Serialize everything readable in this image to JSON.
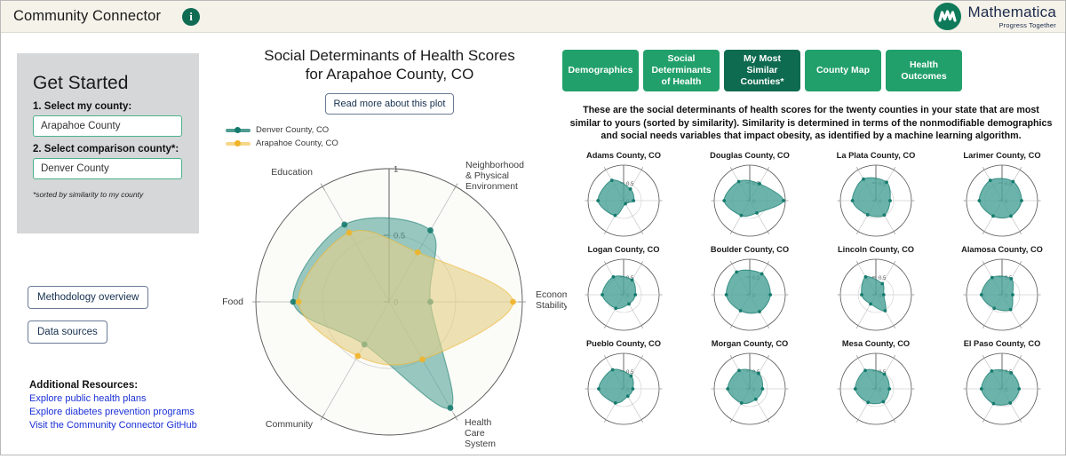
{
  "header": {
    "title": "Community Connector",
    "info_icon": "info-icon",
    "logo_name": "Mathematica",
    "logo_tagline": "Progress Together"
  },
  "sidebar": {
    "title": "Get Started",
    "label_my_county": "1. Select my county:",
    "my_county_value": "Arapahoe County",
    "label_comparison_county": "2. Select comparison county*:",
    "comparison_county_value": "Denver County",
    "note": "*sorted by similarity to my county",
    "buttons": [
      {
        "label": "Methodology overview"
      },
      {
        "label": "Data sources"
      }
    ],
    "resources_title": "Additional Resources:",
    "resources": [
      {
        "label": "Explore public health plans"
      },
      {
        "label": "Explore diabetes prevention programs"
      },
      {
        "label": "Visit the Community Connector GitHub"
      }
    ]
  },
  "chart_panel": {
    "title_line1": "Social Determinants of Health Scores",
    "title_line2": "for Arapahoe County, CO",
    "read_more_label": "Read more about this plot"
  },
  "right_panel": {
    "tabs": [
      {
        "label": "Demographics",
        "active": false
      },
      {
        "label": "Social Determinants of Health",
        "active": false
      },
      {
        "label": "My Most Similar Counties*",
        "active": true
      },
      {
        "label": "County Map",
        "active": false
      },
      {
        "label": "Health Outcomes",
        "active": false
      }
    ],
    "description": "These are the social determinants of health scores for the twenty counties in your state that are most similar to yours (sorted by similarity). Similarity is determined in terms of the nonmodifiable demographics and social needs variables that impact obesity, as identified by a machine learning algorithm."
  },
  "colors": {
    "denver_teal": "#167b6e",
    "denver_fill": "#5aa79d",
    "arapahoe_yellow": "#f0b429",
    "arapahoe_fill": "#e3d089",
    "tab_green": "#22a06b",
    "tab_active_green": "#0f6b4f",
    "link_blue": "#1a2fd6",
    "panel_gray": "#d5d7d9",
    "header_cream": "#f5f2ea"
  },
  "chart_data": {
    "type": "radar",
    "title": "Social Determinants of Health Scores for Arapahoe County, CO",
    "axes": [
      "Neighborhood & Physical Environment",
      "Economic Stability",
      "Health Care System",
      "Community",
      "Food",
      "Education"
    ],
    "axis_label_lines": [
      [
        "Neighborhood",
        "& Physical",
        "Environment"
      ],
      [
        "Economic",
        "Stability"
      ],
      [
        "Health",
        "Care",
        "System"
      ],
      [
        "Community"
      ],
      [
        "Food"
      ],
      [
        "Education"
      ]
    ],
    "radial_ticks": [
      0,
      0.5,
      1
    ],
    "radial_tick_labels": [
      "0",
      "0.5",
      "1"
    ],
    "rlim": [
      0,
      1
    ],
    "series": [
      {
        "name": "Denver County, CO",
        "color": "#167b6e",
        "fill": "#5aa79d",
        "values": [
          0.62,
          0.31,
          0.92,
          0.37,
          0.72,
          0.67
        ]
      },
      {
        "name": "Arapahoe County, CO",
        "color": "#f0b429",
        "fill": "#e3d089",
        "values": [
          0.43,
          0.93,
          0.5,
          0.47,
          0.68,
          0.6
        ]
      }
    ],
    "legend": [
      {
        "label": "Denver County, CO",
        "color": "#167b6e"
      },
      {
        "label": "Arapahoe County, CO",
        "color": "#f0b429"
      }
    ],
    "legend_position": "top-left"
  },
  "small_multiples": {
    "type": "radar-grid",
    "axes": [
      "Neighborhood & Physical Environment",
      "Economic Stability",
      "Health Care System",
      "Community",
      "Food",
      "Education"
    ],
    "radial_ticks": [
      0,
      0.5
    ],
    "radial_tick_labels": [
      "0",
      "0.5"
    ],
    "color": "#167b6e",
    "fill": "#4aa298",
    "charts": [
      {
        "title": "Adams County, CO",
        "values": [
          0.38,
          0.28,
          0.1,
          0.48,
          0.72,
          0.66
        ]
      },
      {
        "title": "Douglas County, CO",
        "values": [
          0.55,
          0.95,
          0.4,
          0.48,
          0.72,
          0.62
        ]
      },
      {
        "title": "La Plata County, CO",
        "values": [
          0.6,
          0.4,
          0.47,
          0.46,
          0.66,
          0.7
        ]
      },
      {
        "title": "Larimer County, CO",
        "values": [
          0.62,
          0.55,
          0.5,
          0.5,
          0.64,
          0.66
        ]
      },
      {
        "title": "Logan County, CO",
        "values": [
          0.48,
          0.33,
          0.3,
          0.44,
          0.6,
          0.58
        ]
      },
      {
        "title": "Boulder County, CO",
        "values": [
          0.68,
          0.58,
          0.55,
          0.52,
          0.66,
          0.74
        ]
      },
      {
        "title": "Lincoln County, CO",
        "values": [
          0.36,
          0.22,
          0.52,
          0.3,
          0.4,
          0.58
        ]
      },
      {
        "title": "Alamosa County, CO",
        "values": [
          0.52,
          0.3,
          0.48,
          0.44,
          0.58,
          0.56
        ]
      },
      {
        "title": "Pueblo County, CO",
        "values": [
          0.42,
          0.26,
          0.24,
          0.46,
          0.7,
          0.62
        ]
      },
      {
        "title": "Morgan County, CO",
        "values": [
          0.5,
          0.36,
          0.34,
          0.46,
          0.62,
          0.6
        ]
      },
      {
        "title": "Mesa County, CO",
        "values": [
          0.48,
          0.38,
          0.42,
          0.44,
          0.58,
          0.6
        ]
      },
      {
        "title": "El Paso County, CO",
        "values": [
          0.52,
          0.48,
          0.46,
          0.48,
          0.58,
          0.58
        ]
      }
    ]
  }
}
